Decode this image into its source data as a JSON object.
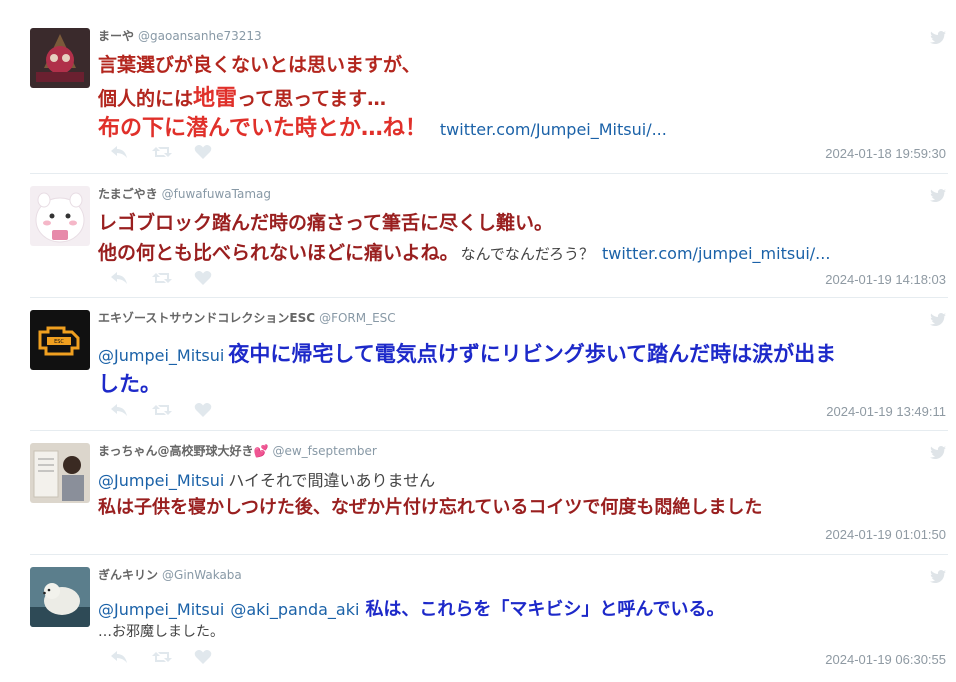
{
  "tweets": [
    {
      "username": "まーや",
      "handle": "@gaoansanhe73213",
      "line1": "言葉選びが良くないとは思いますが、",
      "line2_a": "個人的には",
      "line2_b": "地雷",
      "line2_c": "って思ってます…",
      "line3": "布の下に潜んでいた時とか…ね！",
      "link": "twitter.com/Jumpei_Mitsui/...",
      "timestamp": "2024-01-18 19:59:30"
    },
    {
      "username": "たまごやき",
      "handle": "@fuwafuwaTamag",
      "line1": "レゴブロック踏んだ時の痛さって筆舌に尽くし難い。",
      "line2": "他の何とも比べられないほどに痛いよね。",
      "extra": "なんでなんだろう？",
      "link": "twitter.com/jumpei_mitsui/...",
      "timestamp": "2024-01-19 14:18:03"
    },
    {
      "username": "エキゾーストサウンドコレクションESC",
      "handle": "@FORM_ESC",
      "mention": "@Jumpei_Mitsui",
      "line1": "夜中に帰宅して電気点けずにリビング歩いて踏んだ時は涙が出ま",
      "line2": "した。",
      "timestamp": "2024-01-19 13:49:11"
    },
    {
      "username": "まっちゃん@高校野球大好き💕",
      "handle": "@ew_fseptember",
      "mention": "@Jumpei_Mitsui",
      "line1_rest": "ハイそれで間違いありません",
      "line2": "私は子供を寝かしつけた後、なぜか片付け忘れているコイツで何度も悶絶しました",
      "timestamp": "2024-01-19 01:01:50"
    },
    {
      "username": "ぎんキリン",
      "handle": "@GinWakaba",
      "mention1": "@Jumpei_Mitsui",
      "mention2": "@aki_panda_aki",
      "line1_rest": "私は、これらを「マキビシ」と呼んでいる。",
      "line2": "…お邪魔しました。",
      "timestamp": "2024-01-19 06:30:55"
    }
  ],
  "colors": {
    "highlight_red": "#e0302a",
    "highlight_maroon": "#991f1f",
    "highlight_blue": "#1d29c9",
    "link_blue": "#1b62a8",
    "timestamp_gray": "#8f9aa3"
  },
  "icons": [
    "reply-icon",
    "retweet-icon",
    "like-icon",
    "twitter-bird-icon"
  ]
}
